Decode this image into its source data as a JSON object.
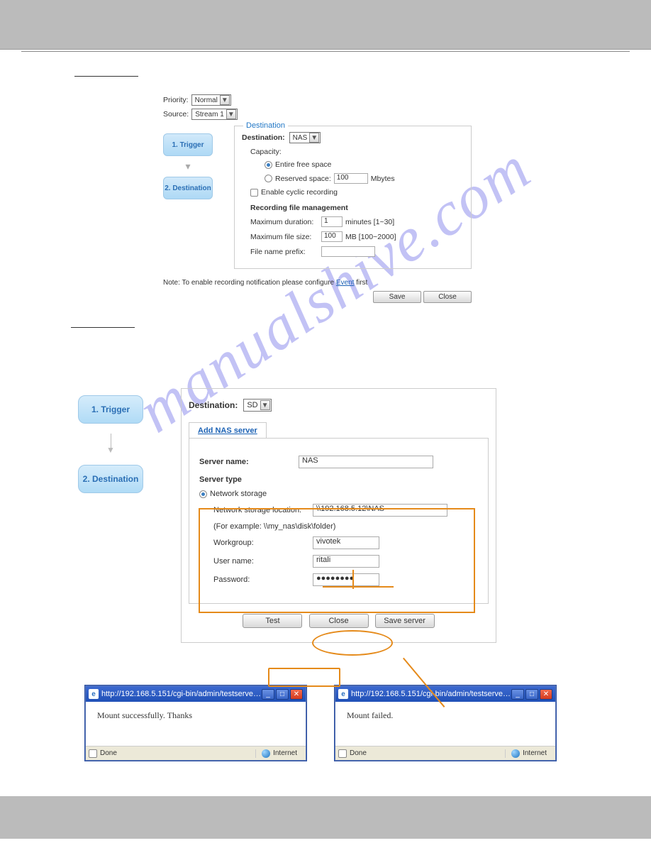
{
  "watermark": "manualshive.com",
  "screenshot1": {
    "priorityLabel": "Priority:",
    "priorityValue": "Normal",
    "sourceLabel": "Source:",
    "sourceValue": "Stream 1",
    "steps": {
      "one": "1. Trigger",
      "two": "2. Destination"
    },
    "panel": {
      "title": "Destination",
      "destLabel": "Destination:",
      "destValue": "NAS",
      "capacityLabel": "Capacity:",
      "entireFree": "Entire free space",
      "reservedLabel": "Reserved space:",
      "reservedValue": "100",
      "reservedUnit": "Mbytes",
      "cyclic": "Enable cyclic recording",
      "rfmHeading": "Recording file management",
      "maxDurLabel": "Maximum duration:",
      "maxDurValue": "1",
      "maxDurUnit": "minutes [1~30]",
      "maxSizeLabel": "Maximum file size:",
      "maxSizeValue": "100",
      "maxSizeUnit": "MB [100~2000]",
      "fnPrefixLabel": "File name prefix:"
    },
    "note": {
      "pre": "Note: To enable recording notification please configure ",
      "link": "Event",
      "post": " first"
    },
    "saveBtn": "Save",
    "closeBtn": "Close"
  },
  "screenshot2": {
    "steps": {
      "one": "1. Trigger",
      "two": "2. Destination"
    },
    "destLabel": "Destination:",
    "destValue": "SD",
    "tabLink": "Add NAS server",
    "serverNameLabel": "Server name:",
    "serverNameValue": "NAS",
    "serverTypeHeading": "Server type",
    "networkStorage": "Network storage",
    "nslLabel": "Network storage location:",
    "nslValue": "\\\\192.168.5.12\\NAS",
    "example": "(For example: \\\\my_nas\\disk\\folder)",
    "workgroupLabel": "Workgroup:",
    "workgroupValue": "vivotek",
    "usernameLabel": "User name:",
    "usernameValue": "ritali",
    "passwordLabel": "Password:",
    "passwordValue": "●●●●●●●●",
    "testBtn": "Test",
    "closeBtn": "Close",
    "saveServerBtn": "Save server"
  },
  "popup": {
    "url": "http://192.168.5.151/cgi-bin/admin/testserver...",
    "successMsg": "Mount successfully. Thanks",
    "failMsg": "Mount failed.",
    "done": "Done",
    "internet": "Internet"
  }
}
